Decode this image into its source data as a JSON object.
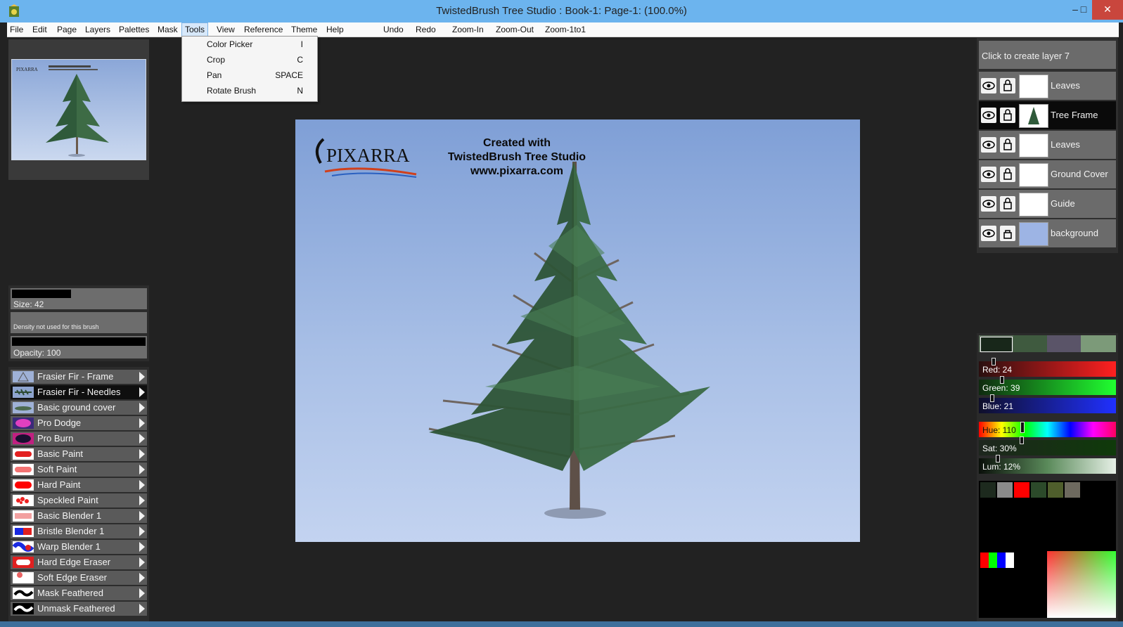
{
  "window": {
    "title": "TwistedBrush Tree Studio : Book-1: Page-1:  (100.0%)",
    "minimize_glyph": "–",
    "maximize_glyph": "□",
    "close_glyph": "✕"
  },
  "menu": {
    "items": [
      "File",
      "Edit",
      "Page",
      "Layers",
      "Palettes",
      "Mask",
      "Tools",
      "View",
      "Reference",
      "Theme",
      "Help"
    ],
    "active": "Tools",
    "actions": [
      "Undo",
      "Redo",
      "Zoom-In",
      "Zoom-Out",
      "Zoom-1to1"
    ]
  },
  "tools_menu": [
    {
      "label": "Color Picker",
      "shortcut": "I"
    },
    {
      "label": "Crop",
      "shortcut": "C"
    },
    {
      "label": "Pan",
      "shortcut": "SPACE"
    },
    {
      "label": "Rotate Brush",
      "shortcut": "N"
    }
  ],
  "brush_controls": {
    "size": "Size: 42",
    "density": "Density not used for this brush",
    "opacity": "Opacity: 100"
  },
  "brushes": [
    {
      "label": "Frasier Fir - Frame",
      "icon": "fir-frame-icon",
      "selected": false
    },
    {
      "label": "Frasier Fir - Needles",
      "icon": "fir-needles-icon",
      "selected": true
    },
    {
      "label": "Basic ground cover",
      "icon": "ground-cover-icon",
      "selected": false
    },
    {
      "label": "Pro Dodge",
      "icon": "dodge-icon",
      "selected": false
    },
    {
      "label": "Pro Burn",
      "icon": "burn-icon",
      "selected": false
    },
    {
      "label": "Basic Paint",
      "icon": "paint-stroke-icon",
      "selected": false
    },
    {
      "label": "Soft Paint",
      "icon": "soft-stroke-icon",
      "selected": false
    },
    {
      "label": "Hard Paint",
      "icon": "hard-stroke-icon",
      "selected": false
    },
    {
      "label": "Speckled Paint",
      "icon": "speckle-icon",
      "selected": false
    },
    {
      "label": "Basic Blender 1",
      "icon": "blender-icon",
      "selected": false
    },
    {
      "label": "Bristle Blender 1",
      "icon": "bristle-blender-icon",
      "selected": false
    },
    {
      "label": "Warp Blender 1",
      "icon": "warp-blender-icon",
      "selected": false
    },
    {
      "label": "Hard Edge Eraser",
      "icon": "hard-eraser-icon",
      "selected": false
    },
    {
      "label": "Soft Edge Eraser",
      "icon": "soft-eraser-icon",
      "selected": false
    },
    {
      "label": "Mask Feathered",
      "icon": "mask-icon",
      "selected": false
    },
    {
      "label": "Unmask Feathered",
      "icon": "unmask-icon",
      "selected": false
    }
  ],
  "canvas": {
    "credit_line1": "Created with",
    "credit_line2": "TwistedBrush Tree Studio",
    "credit_line3": "www.pixarra.com",
    "logo_text": "PIXARRA"
  },
  "layers": {
    "header": "Click to create layer 7",
    "items": [
      {
        "name": "Leaves",
        "selected": false,
        "thumb": "#ffffff"
      },
      {
        "name": "Tree Frame",
        "selected": true,
        "thumb": "#ffffff"
      },
      {
        "name": "Leaves",
        "selected": false,
        "thumb": "#ffffff"
      },
      {
        "name": "Ground Cover",
        "selected": false,
        "thumb": "#ffffff"
      },
      {
        "name": "Guide",
        "selected": false,
        "thumb": "#ffffff"
      },
      {
        "name": "background",
        "selected": false,
        "thumb": "#9db4e4"
      }
    ]
  },
  "color": {
    "current_swatches": [
      "#18271a",
      "#3f5a3f",
      "#5a5468",
      "#7c9a79"
    ],
    "red": {
      "label": "Red: 24",
      "value": 24
    },
    "green": {
      "label": "Green: 39",
      "value": 39
    },
    "blue": {
      "label": "Blue: 21",
      "value": 21
    },
    "hue": {
      "label": "Hue: 110",
      "value": 110
    },
    "sat": {
      "label": "Sat: 30%",
      "value": 30
    },
    "lum": {
      "label": "Lum: 12%",
      "value": 12
    },
    "palette": [
      "#1d2a1e",
      "#8a8a8a",
      "#ff0000",
      "#2c4a2a",
      "#4f5e2c",
      "#6e6a5f"
    ]
  }
}
